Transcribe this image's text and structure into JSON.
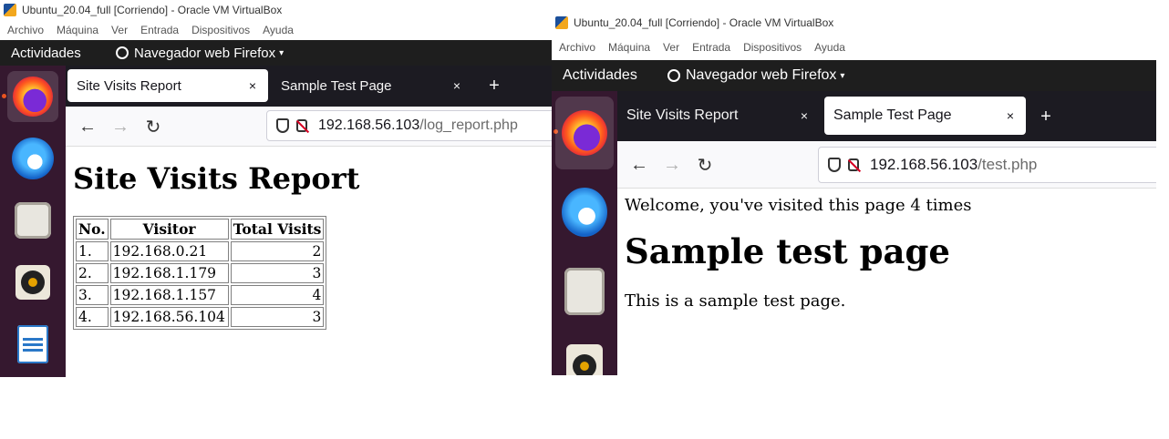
{
  "left_vm": {
    "window_title": "Ubuntu_20.04_full [Corriendo] - Oracle VM VirtualBox",
    "menu": [
      "Archivo",
      "Máquina",
      "Ver",
      "Entrada",
      "Dispositivos",
      "Ayuda"
    ],
    "topbar": {
      "activities": "Actividades",
      "app_name": "Navegador web Firefox"
    },
    "tabs": [
      {
        "label": "Site Visits Report",
        "selected": true
      },
      {
        "label": "Sample Test Page",
        "selected": false
      }
    ],
    "url": {
      "host": "192.168.56.103",
      "path": "/log_report.php"
    },
    "page": {
      "heading": "Site Visits Report",
      "table": {
        "headers": [
          "No.",
          "Visitor",
          "Total Visits"
        ],
        "rows": [
          [
            "1.",
            "192.168.0.21",
            "2"
          ],
          [
            "2.",
            "192.168.1.179",
            "3"
          ],
          [
            "3.",
            "192.168.1.157",
            "4"
          ],
          [
            "4.",
            "192.168.56.104",
            "3"
          ]
        ]
      }
    }
  },
  "right_vm": {
    "window_title": "Ubuntu_20.04_full [Corriendo] - Oracle VM VirtualBox",
    "menu": [
      "Archivo",
      "Máquina",
      "Ver",
      "Entrada",
      "Dispositivos",
      "Ayuda"
    ],
    "topbar": {
      "activities": "Actividades",
      "app_name": "Navegador web Firefox"
    },
    "tabs": [
      {
        "label": "Site Visits Report",
        "selected": false
      },
      {
        "label": "Sample Test Page",
        "selected": true
      }
    ],
    "url": {
      "host": "192.168.56.103",
      "path": "/test.php"
    },
    "page": {
      "welcome": "Welcome, you've visited this page 4 times",
      "heading": "Sample test page",
      "paragraph": "This is a sample test page."
    }
  },
  "icons": {
    "close": "×",
    "new_tab": "+",
    "back": "←",
    "forward": "→",
    "reload": "↻",
    "caret": "▾"
  }
}
